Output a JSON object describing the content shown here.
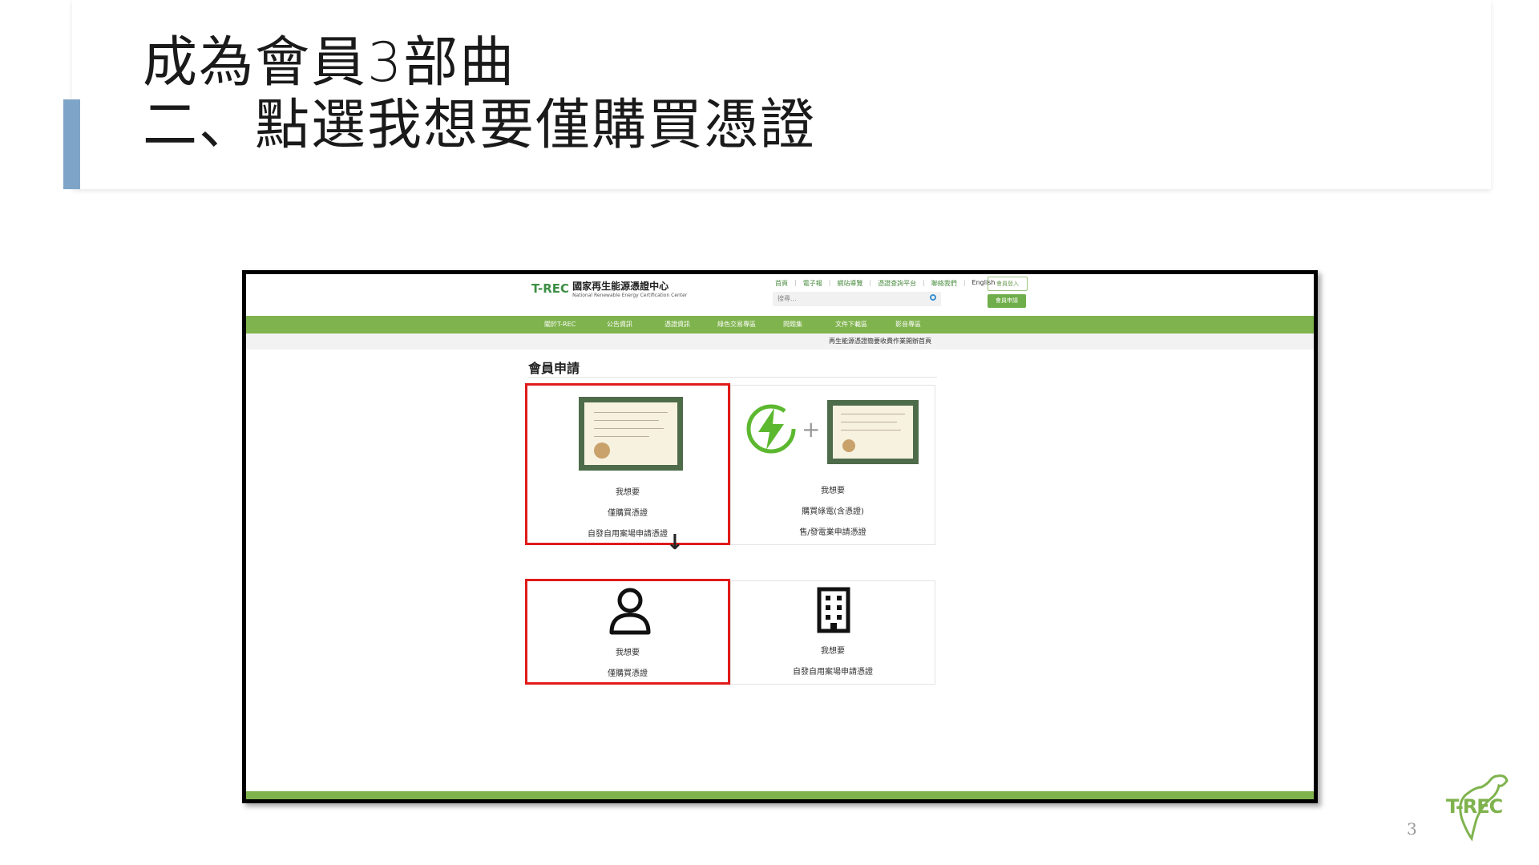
{
  "slide": {
    "title_line1": "成為會員3部曲",
    "title_line2": "二、點選我想要僅購買憑證",
    "page_number": "3",
    "accent_color": "#7ea5c7",
    "corner_logo_text": "T-REC"
  },
  "site": {
    "logo_mark": "T-REC",
    "logo_cn": "國家再生能源憑證中心",
    "logo_en": "National Renewable Energy Certification Center",
    "top_links": [
      "首頁",
      "電子報",
      "網站導覽",
      "憑證查詢平台",
      "聯絡我們",
      "English"
    ],
    "login_label": "會員登入",
    "search_placeholder": "搜尋...",
    "join_label": "會員申請",
    "nav": [
      "關於T-REC",
      "公告資訊",
      "憑證資訊",
      "綠色交易專區",
      "問題集",
      "文件下載區",
      "影音專區"
    ],
    "notice": "再生能源憑證簡要收費作業開辦首頁",
    "brand_green": "#7fb34d",
    "page_heading": "會員申請"
  },
  "options": [
    {
      "line1": "我想要",
      "line2": "僅購買憑證",
      "line3": "自發自用案場申請憑證",
      "selected": true
    },
    {
      "line1": "我想要",
      "line2": "購買綠電(含憑證)",
      "line3": "售/發電業申請憑證",
      "selected": false
    }
  ],
  "member_types": [
    {
      "icon": "person-icon",
      "line1": "我想要",
      "line2": "僅購買憑證",
      "selected": true
    },
    {
      "icon": "building-icon",
      "line1": "我想要",
      "line2": "自發自用案場申請憑證",
      "selected": false
    }
  ],
  "highlight_color": "#e01b1b"
}
